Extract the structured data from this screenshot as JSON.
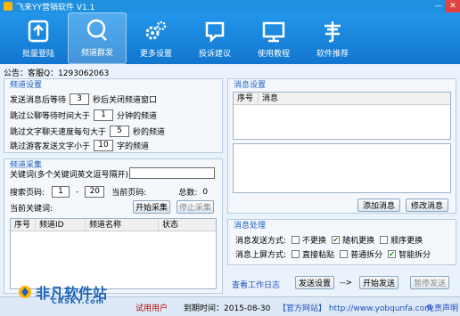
{
  "window": {
    "title": "飞来YY营销软件 V1.1",
    "minimize": "—",
    "close": "✕"
  },
  "toolbar": [
    {
      "label": "批量登陆",
      "icon": "upload-icon"
    },
    {
      "label": "频道群发",
      "icon": "chat-bubble-icon"
    },
    {
      "label": "更多设置",
      "icon": "gears-icon"
    },
    {
      "label": "投诉建议",
      "icon": "feedback-icon"
    },
    {
      "label": "使用教程",
      "icon": "tutorial-screen-icon"
    },
    {
      "label": "软件推荐",
      "icon": "recommend-glyph-icon"
    }
  ],
  "notice": "公告：客服Q：1293062063",
  "channel_settings": {
    "title": "频道设置",
    "r1_pre": "发送消息后等待",
    "r1_val": "3",
    "r1_post": "秒后关闭频道窗口",
    "r2_pre": "跳过公聊等待时间大于",
    "r2_val": "1",
    "r2_post": "分钟的频道",
    "r3_pre": "跳过文字聊天速度每句大于",
    "r3_val": "5",
    "r3_post": "秒的频道",
    "r4_pre": "跳过游客发送文字小于",
    "r4_val": "10",
    "r4_post": "字的频道"
  },
  "channel_collect": {
    "title": "频道采集",
    "keyword_label": "关键词(多个关键词英文逗号隔开):",
    "keyword_value": "",
    "page_label": "搜索页码:",
    "page_from": "1",
    "page_sep": "-",
    "page_to": "20",
    "current_page_label": "当前页码:",
    "current_page_value": "",
    "total_label": "总数:",
    "total_value": "0",
    "current_keyword_label": "当前关键词:",
    "current_keyword_value": "",
    "start_button": "开始采集",
    "stop_button": "停止采集",
    "columns": [
      "序号",
      "频道ID",
      "频道名称",
      "状态"
    ]
  },
  "message_settings": {
    "title": "消息设置",
    "columns": [
      "序号",
      "消息"
    ],
    "add_button": "添加消息",
    "edit_button": "修改消息"
  },
  "message_processing": {
    "title": "消息处理",
    "send_mode_label": "消息发送方式:",
    "send_options": [
      {
        "label": "不更换",
        "checked": false
      },
      {
        "label": "随机更换",
        "checked": true
      },
      {
        "label": "顺序更换",
        "checked": false
      }
    ],
    "upload_mode_label": "消息上屏方式:",
    "upload_options": [
      {
        "label": "直接粘贴",
        "checked": false
      },
      {
        "label": "普通拆分",
        "checked": false
      },
      {
        "label": "智能拆分",
        "checked": true
      }
    ],
    "check_mark": "✔"
  },
  "actions": {
    "view_log": "查看工作日志",
    "send_settings": "发送设置",
    "arrow": "-->",
    "start_send": "开始发送",
    "pause_send": "暂停发送"
  },
  "statusbar": {
    "user_type": "试用用户",
    "expire": "到期时间：2015-08-30",
    "site": "【官方网站】 http://www.yobqunfa.com",
    "disclaimer": "免责声明"
  },
  "watermark": {
    "text": "非凡软件站",
    "sub": "CRSKY.com"
  },
  "colors": {
    "accent": "#1f8fe0",
    "title_blue": "#1f5fbf",
    "check_green": "#1a8a1a"
  }
}
